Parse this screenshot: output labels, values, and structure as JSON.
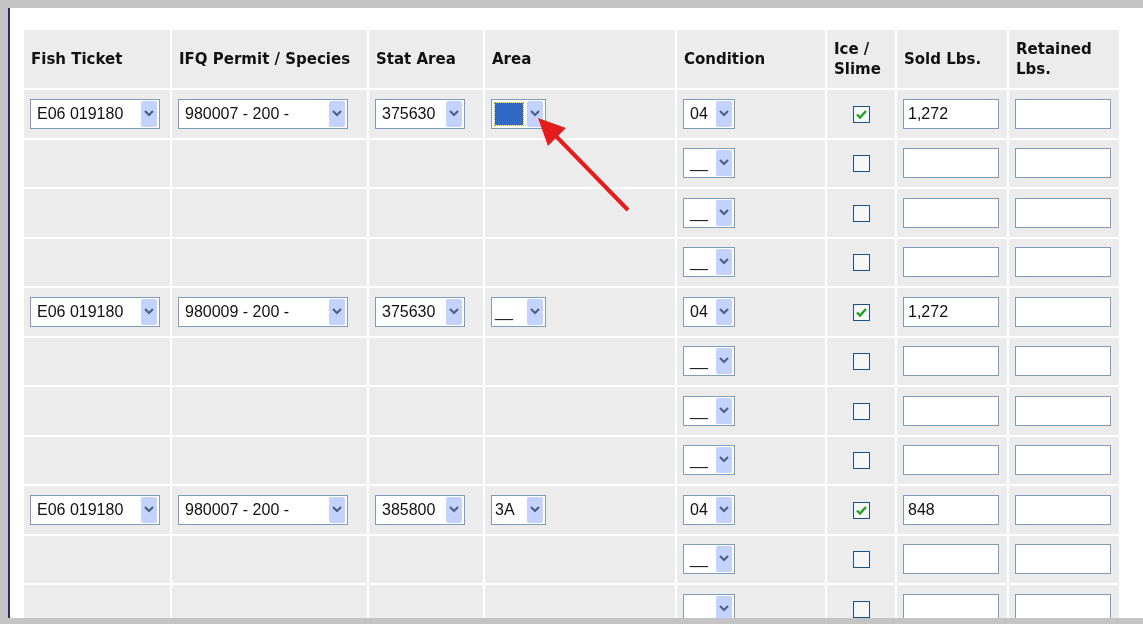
{
  "columns": [
    "Fish Ticket",
    "IFQ Permit / Species",
    "Stat Area",
    "Area",
    "Condition",
    "Ice / Slime",
    "Sold Lbs.",
    "Retained Lbs."
  ],
  "groups": [
    {
      "fish_ticket": "E06 019180",
      "permit_species": "980007 - 200 -",
      "stat_area": "375630",
      "area": {
        "highlighted": true
      },
      "lines": [
        {
          "condition": "04",
          "ice_slime": true,
          "sold_lbs": "1,272"
        },
        {
          "condition": "__",
          "ice_slime": false
        },
        {
          "condition": "__",
          "ice_slime": false
        },
        {
          "condition": "__",
          "ice_slime": false
        }
      ]
    },
    {
      "fish_ticket": "E06 019180",
      "permit_species": "980009 - 200 -",
      "stat_area": "375630",
      "area": {
        "value": "__",
        "highlighted": false
      },
      "lines": [
        {
          "condition": "04",
          "ice_slime": true,
          "sold_lbs": "1,272"
        },
        {
          "condition": "__",
          "ice_slime": false
        },
        {
          "condition": "__",
          "ice_slime": false
        },
        {
          "condition": "__",
          "ice_slime": false
        }
      ]
    },
    {
      "fish_ticket": "E06 019180",
      "permit_species": "980007 - 200 -",
      "stat_area": "385800",
      "area": {
        "value": "3A",
        "highlighted": false
      },
      "lines": [
        {
          "condition": "04",
          "ice_slime": true,
          "sold_lbs": "848"
        },
        {
          "condition": "__",
          "ice_slime": false
        },
        {
          "ice_slime": false
        }
      ]
    }
  ]
}
